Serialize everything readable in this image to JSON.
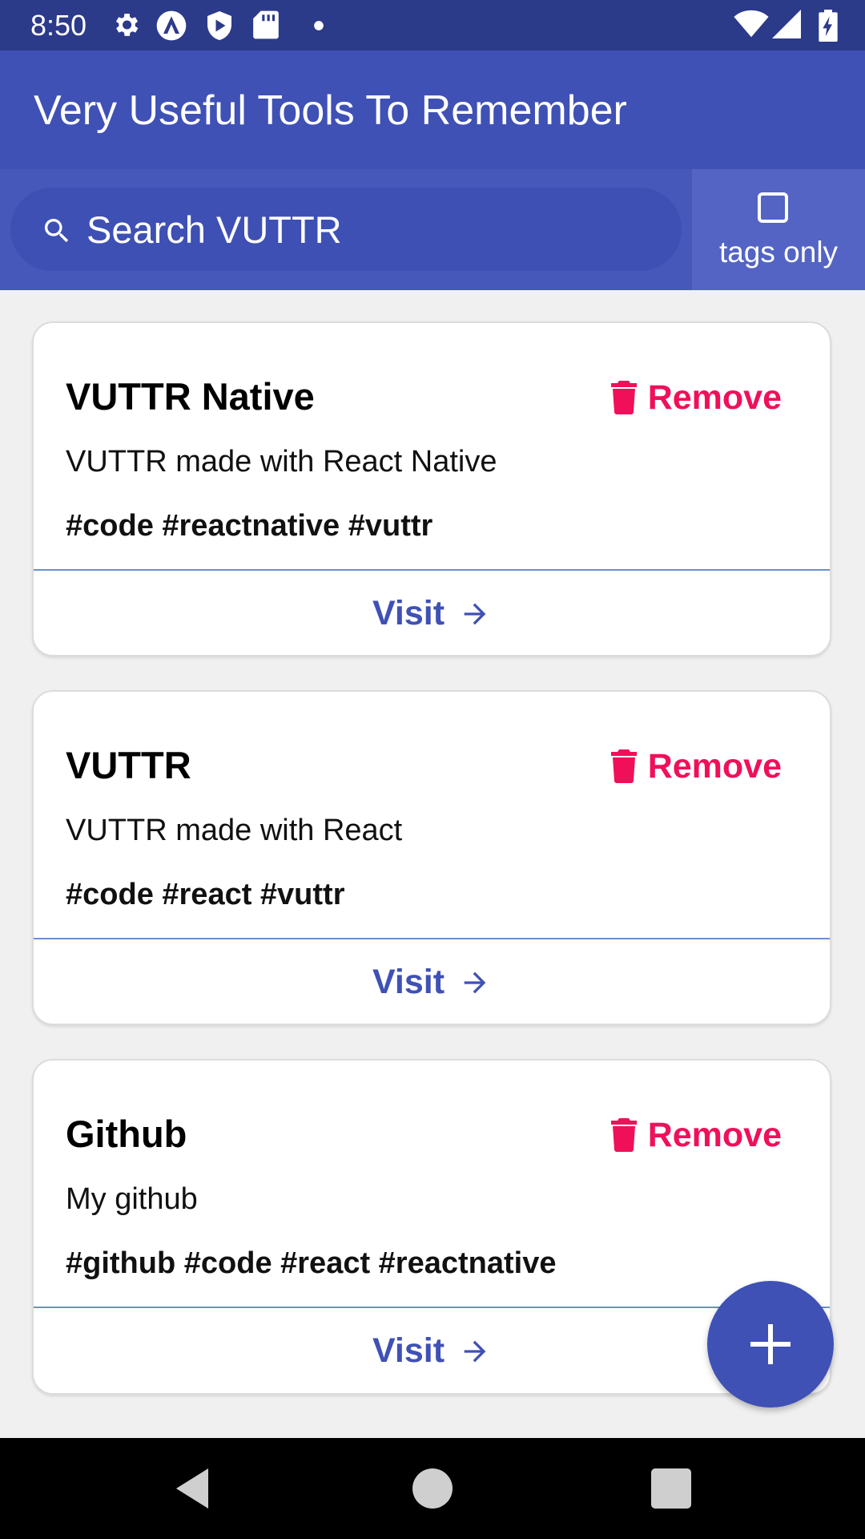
{
  "status_bar": {
    "time": "8:50",
    "icons_left": [
      "gear-icon",
      "autofill-icon",
      "play-protect-icon",
      "sd-card-icon",
      "dot-icon"
    ],
    "icons_right": [
      "wifi-icon",
      "cell-signal-icon",
      "battery-charging-icon"
    ]
  },
  "app_bar": {
    "title": "Very Useful Tools To Remember",
    "color": "#3f51b5"
  },
  "search": {
    "placeholder": "Search VUTTR",
    "value": ""
  },
  "tags_toggle": {
    "label": "tags only",
    "checked": false
  },
  "tools": [
    {
      "title": "VUTTR Native",
      "description": "VUTTR made with React Native",
      "tags": "#code #reactnative #vuttr",
      "remove_label": "Remove",
      "visit_label": "Visit"
    },
    {
      "title": "VUTTR",
      "description": "VUTTR made with React",
      "tags": "#code #react #vuttr",
      "remove_label": "Remove",
      "visit_label": "Visit"
    },
    {
      "title": "Github",
      "description": "My github",
      "tags": "#github #code #react #reactnative",
      "remove_label": "Remove",
      "visit_label": "Visit"
    }
  ],
  "fab": {
    "icon": "plus-icon"
  },
  "colors": {
    "primary": "#3f51b5",
    "status_bar": "#2c3a8a",
    "remove": "#f0105a",
    "background": "#f0f0f0"
  },
  "nav_bar": {
    "buttons": [
      "back-icon",
      "home-icon",
      "recents-icon"
    ]
  }
}
